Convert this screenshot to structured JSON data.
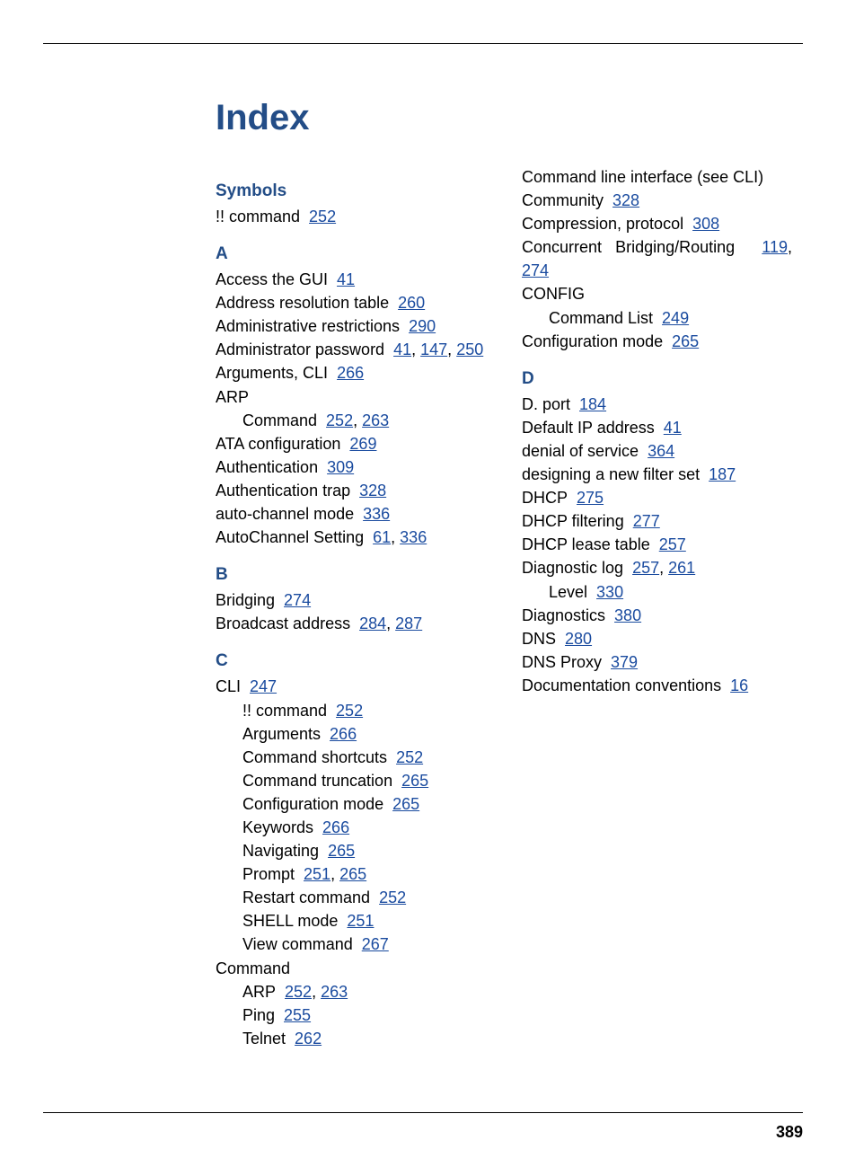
{
  "title": "Index",
  "page_number": "389",
  "sections": [
    {
      "heading": "Symbols",
      "entries": [
        {
          "text": "!! command",
          "pages": [
            "252"
          ],
          "sub": false
        }
      ]
    },
    {
      "heading": "A",
      "entries": [
        {
          "text": "Access the GUI",
          "pages": [
            "41"
          ],
          "sub": false
        },
        {
          "text": "Address resolution table",
          "pages": [
            "260"
          ],
          "sub": false
        },
        {
          "text": "Administrative restrictions",
          "pages": [
            "290"
          ],
          "sub": false
        },
        {
          "text": "Administrator password",
          "pages": [
            "41",
            "147",
            "250"
          ],
          "sub": false
        },
        {
          "text": "Arguments, CLI",
          "pages": [
            "266"
          ],
          "sub": false
        },
        {
          "text": "ARP",
          "pages": [],
          "sub": false
        },
        {
          "text": "Command",
          "pages": [
            "252",
            "263"
          ],
          "sub": true
        },
        {
          "text": "ATA configuration",
          "pages": [
            "269"
          ],
          "sub": false
        },
        {
          "text": "Authentication",
          "pages": [
            "309"
          ],
          "sub": false
        },
        {
          "text": "Authentication trap",
          "pages": [
            "328"
          ],
          "sub": false
        },
        {
          "text": "auto-channel mode",
          "pages": [
            "336"
          ],
          "sub": false
        },
        {
          "text": "AutoChannel Setting",
          "pages": [
            "61",
            "336"
          ],
          "sub": false
        }
      ]
    },
    {
      "heading": "B",
      "entries": [
        {
          "text": "Bridging",
          "pages": [
            "274"
          ],
          "sub": false
        },
        {
          "text": "Broadcast address",
          "pages": [
            "284",
            "287"
          ],
          "sub": false
        }
      ]
    },
    {
      "heading": "C",
      "entries": [
        {
          "text": "CLI",
          "pages": [
            "247"
          ],
          "sub": false
        },
        {
          "text": "!! command",
          "pages": [
            "252"
          ],
          "sub": true
        },
        {
          "text": "Arguments",
          "pages": [
            "266"
          ],
          "sub": true
        },
        {
          "text": "Command shortcuts",
          "pages": [
            "252"
          ],
          "sub": true
        },
        {
          "text": "Command truncation",
          "pages": [
            "265"
          ],
          "sub": true
        },
        {
          "text": "Configuration mode",
          "pages": [
            "265"
          ],
          "sub": true
        },
        {
          "text": "Keywords",
          "pages": [
            "266"
          ],
          "sub": true
        },
        {
          "text": "Navigating",
          "pages": [
            "265"
          ],
          "sub": true
        },
        {
          "text": "Prompt",
          "pages": [
            "251",
            "265"
          ],
          "sub": true
        },
        {
          "text": "Restart command",
          "pages": [
            "252"
          ],
          "sub": true
        },
        {
          "text": "SHELL mode",
          "pages": [
            "251"
          ],
          "sub": true
        },
        {
          "text": "View command",
          "pages": [
            "267"
          ],
          "sub": true
        },
        {
          "text": "Command",
          "pages": [],
          "sub": false
        },
        {
          "text": "ARP",
          "pages": [
            "252",
            "263"
          ],
          "sub": true
        },
        {
          "text": "Ping",
          "pages": [
            "255"
          ],
          "sub": true
        },
        {
          "text": "Telnet",
          "pages": [
            "262"
          ],
          "sub": true
        },
        {
          "text": "Command line interface (see CLI)",
          "pages": [],
          "sub": false
        },
        {
          "text": "Community",
          "pages": [
            "328"
          ],
          "sub": false
        },
        {
          "text": "Compression, protocol",
          "pages": [
            "308"
          ],
          "sub": false
        },
        {
          "text": "Concurrent Bridging/Routing",
          "pages": [
            "119",
            "274"
          ],
          "sub": false
        },
        {
          "text": "CONFIG",
          "pages": [],
          "sub": false
        },
        {
          "text": "Command List",
          "pages": [
            "249"
          ],
          "sub": true
        },
        {
          "text": "Configuration mode",
          "pages": [
            "265"
          ],
          "sub": false
        }
      ]
    },
    {
      "heading": "D",
      "entries": [
        {
          "text": "D. port",
          "pages": [
            "184"
          ],
          "sub": false
        },
        {
          "text": "Default IP address",
          "pages": [
            "41"
          ],
          "sub": false
        },
        {
          "text": "denial of service",
          "pages": [
            "364"
          ],
          "sub": false
        },
        {
          "text": "designing a new filter set",
          "pages": [
            "187"
          ],
          "sub": false
        },
        {
          "text": "DHCP",
          "pages": [
            "275"
          ],
          "sub": false
        },
        {
          "text": "DHCP filtering",
          "pages": [
            "277"
          ],
          "sub": false
        },
        {
          "text": "DHCP lease table",
          "pages": [
            "257"
          ],
          "sub": false
        },
        {
          "text": "Diagnostic log",
          "pages": [
            "257",
            "261"
          ],
          "sub": false
        },
        {
          "text": "Level",
          "pages": [
            "330"
          ],
          "sub": true
        },
        {
          "text": "Diagnostics",
          "pages": [
            "380"
          ],
          "sub": false
        },
        {
          "text": "DNS",
          "pages": [
            "280"
          ],
          "sub": false
        },
        {
          "text": "DNS Proxy",
          "pages": [
            "379"
          ],
          "sub": false
        },
        {
          "text": "Documentation conventions",
          "pages": [
            "16"
          ],
          "sub": false
        }
      ]
    }
  ]
}
